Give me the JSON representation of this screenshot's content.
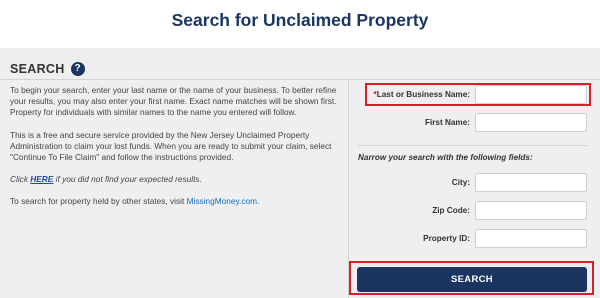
{
  "header": {
    "title": "Search for Unclaimed Property"
  },
  "section": {
    "title": "SEARCH",
    "help_icon": "?"
  },
  "intro": {
    "p1": "To begin your search, enter your last name or the name of your business. To better refine your results, you may also enter your first name. Exact name matches will be shown first. Property for individuals with similar names to the name you entered will follow.",
    "p2": "This is a free and secure service provided by the New Jersey Unclaimed Property Administration to claim your lost funds. When you are ready to submit your claim, select \"Continue To File Claim\" and follow the instructions provided.",
    "p3_pre": "Click ",
    "p3_link": "HERE",
    "p3_post": " if you did not find your expected results.",
    "p4_pre": "To search for property held by other states, visit ",
    "p4_link": "MissingMoney.com",
    "p4_post": "."
  },
  "form": {
    "required_mark": "*",
    "last_name_label": "Last or Business Name:",
    "last_name_value": "",
    "first_name_label": "First Name:",
    "first_name_value": "",
    "narrow_text": "Narrow your search with the following fields:",
    "city_label": "City:",
    "city_value": "",
    "zip_label": "Zip Code:",
    "zip_value": "",
    "property_id_label": "Property ID:",
    "property_id_value": "",
    "search_button": "SEARCH"
  },
  "colors": {
    "brand_navy": "#1b3561",
    "highlight_red": "#d62027",
    "panel_bg": "#efefef"
  }
}
